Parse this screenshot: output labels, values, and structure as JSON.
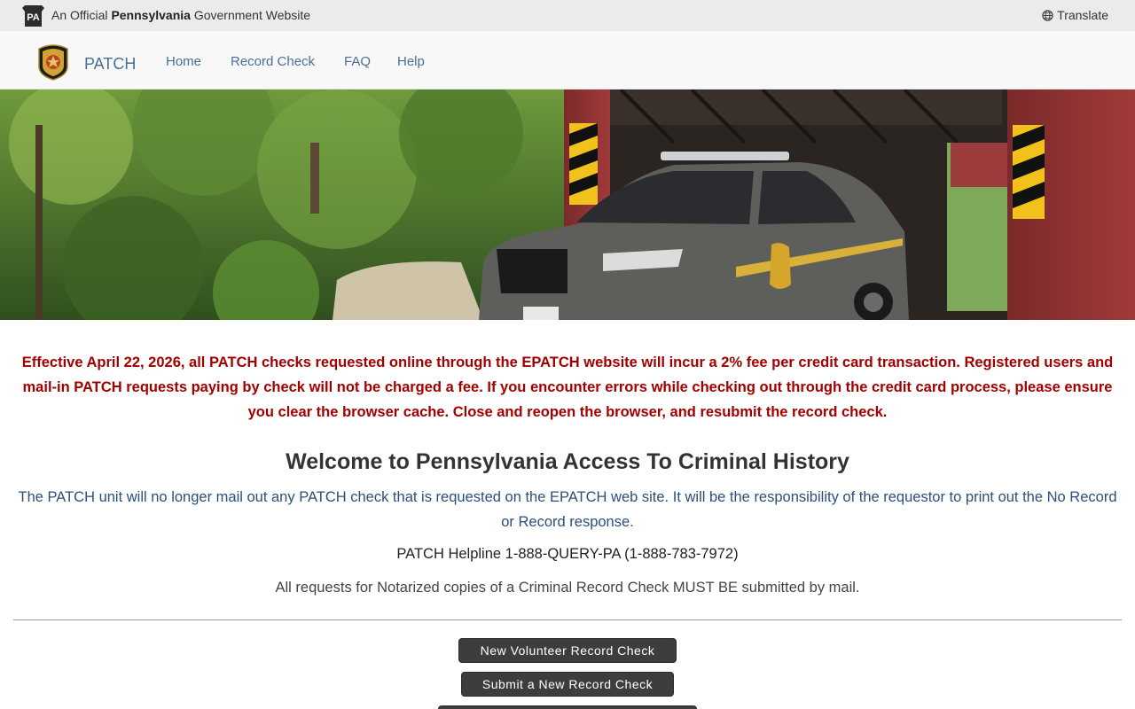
{
  "gov_banner": {
    "logo_text": "PA",
    "prefix": "An Official",
    "state": "Pennsylvania",
    "suffix": "Government Website",
    "translate_label": "Translate"
  },
  "navbar": {
    "brand": "PATCH",
    "links": [
      "Home",
      "Record Check",
      "FAQ",
      "Help"
    ]
  },
  "notice": "Effective April 22, 2026, all PATCH checks requested online through the EPATCH website will incur a 2% fee per credit card transaction. Registered users and mail-in PATCH requests paying by check will not be charged a fee. If you encounter errors while checking out through the credit card process, please ensure you clear the browser cache. Close and reopen the browser, and resubmit the record check.",
  "welcome_title": "Welcome to Pennsylvania Access To Criminal History",
  "mail_note": "The PATCH unit will no longer mail out any PATCH check that is requested on the EPATCH web site. It will be the responsibility of the requestor to print out the No Record or Record response.",
  "helpline": "PATCH Helpline 1-888-QUERY-PA (1-888-783-7972)",
  "notarized_note": "All requests for Notarized copies of a Criminal Record Check MUST BE submitted by mail.",
  "buttons": {
    "volunteer": "New Volunteer Record Check",
    "submit": "Submit a New Record Check"
  },
  "colors": {
    "notice_red": "#a30000",
    "link_blue": "#4b6f94",
    "button_dark": "#3d3d3d"
  }
}
